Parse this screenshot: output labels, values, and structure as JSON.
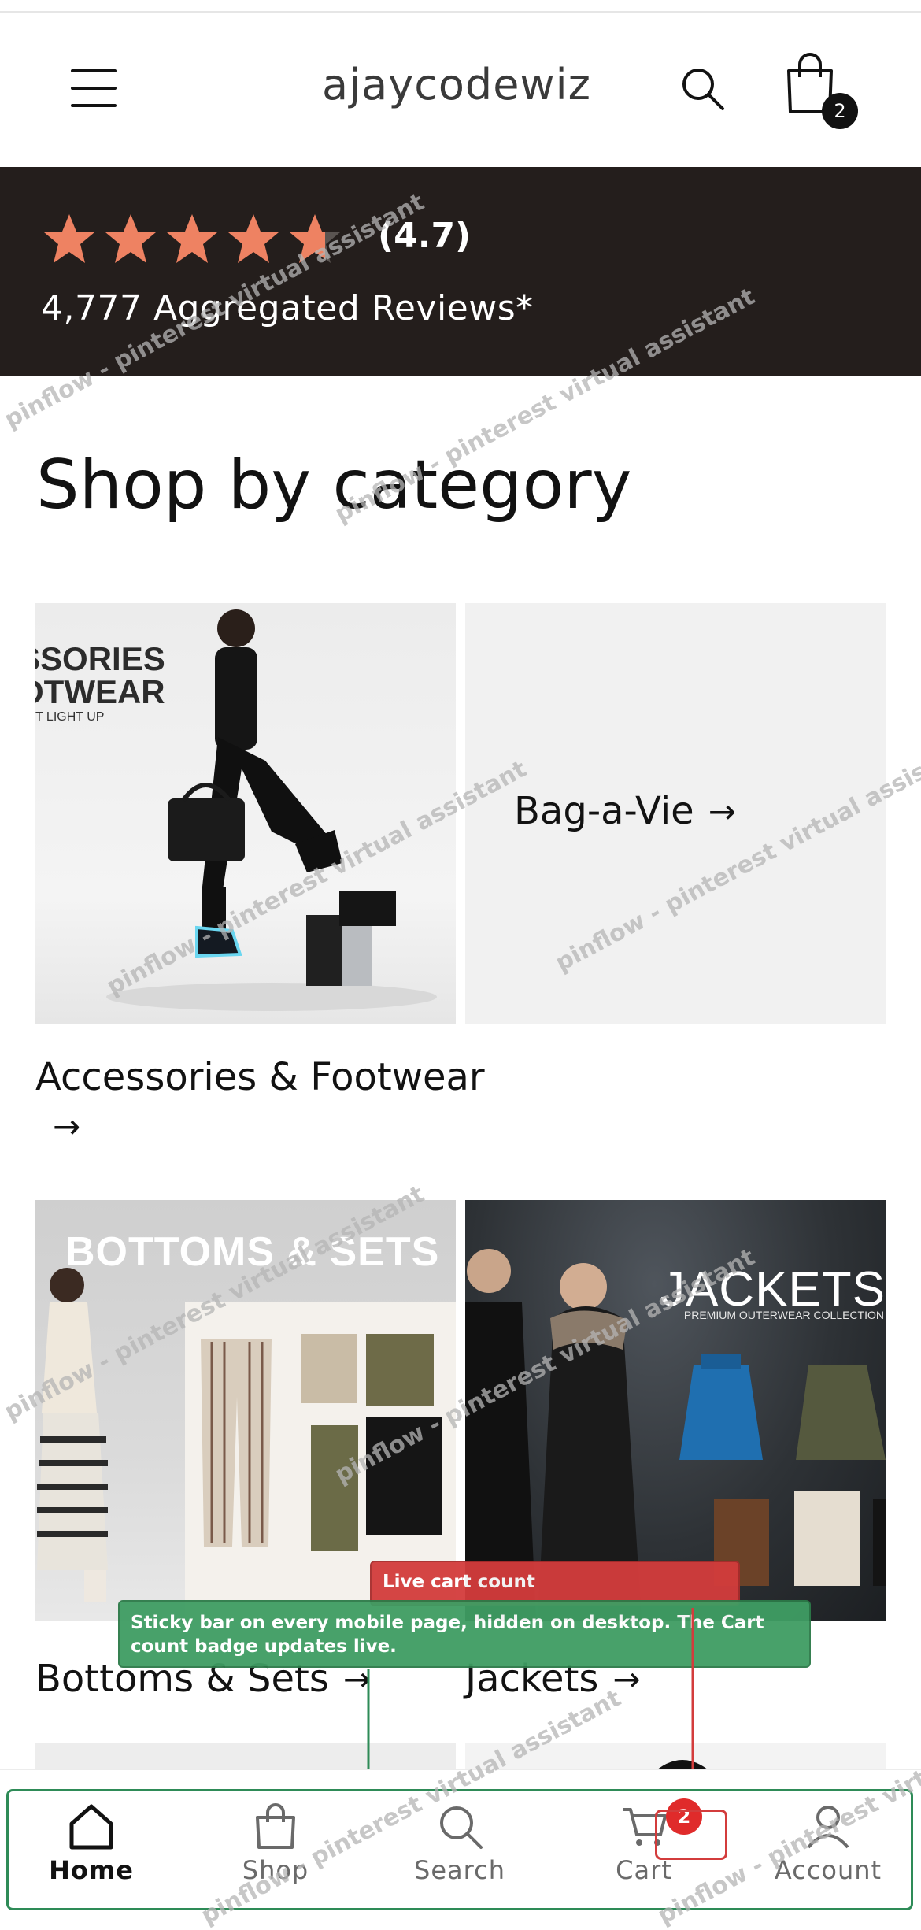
{
  "header": {
    "brand": "ajaycodewiz",
    "cart_count": "2"
  },
  "rating": {
    "value": "(4.7)",
    "stars": 4.7,
    "reviews": "4,777 Aggregated Reviews*",
    "star_color": "#ee8262"
  },
  "section": {
    "title": "Shop by category"
  },
  "categories": [
    {
      "label": "Accessories & Footwear",
      "arrow": "→",
      "image_text": "SSORIES",
      "image_text2": "OTWEAR",
      "image_text3": "T LIGHT UP"
    },
    {
      "label": "Bag-a-Vie",
      "arrow": "→"
    },
    {
      "label": "Bottoms & Sets",
      "arrow": "→",
      "image_text": "BOTTOMS & SETS"
    },
    {
      "label": "Jackets",
      "arrow": "→",
      "image_text": "JACKETS",
      "image_subtext": "PREMIUM OUTERWEAR COLLECTION"
    }
  ],
  "annotations": {
    "red": "Live cart count",
    "green": "Sticky bar on every mobile page, hidden on desktop. The Cart count badge updates live."
  },
  "bottom_nav": {
    "items": [
      {
        "label": "Home",
        "icon": "home-icon"
      },
      {
        "label": "Shop",
        "icon": "shopping-bag-icon"
      },
      {
        "label": "Search",
        "icon": "search-icon"
      },
      {
        "label": "Cart",
        "icon": "cart-icon"
      },
      {
        "label": "Account",
        "icon": "account-icon"
      }
    ],
    "cart_badge": "2",
    "badge_color": "#e02b2b"
  },
  "watermark": "pinflow - pinterest virtual assistant"
}
